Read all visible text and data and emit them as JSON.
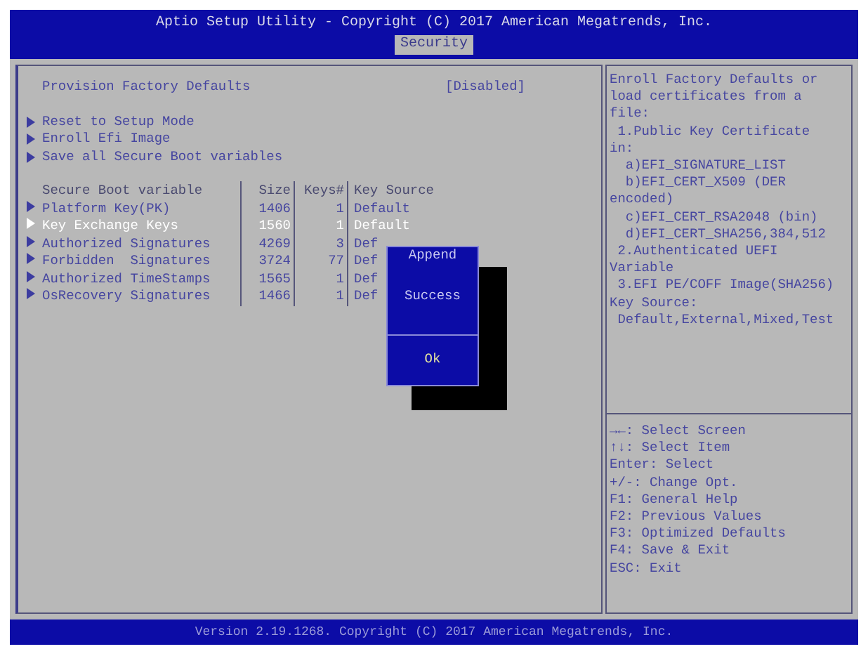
{
  "header": {
    "title": "Aptio Setup Utility - Copyright (C) 2017 American Megatrends, Inc.",
    "tabs": [
      {
        "label": "Security",
        "selected": true
      }
    ]
  },
  "settings": [
    {
      "kind": "option",
      "label": "Provision Factory Defaults",
      "value": "[Disabled]"
    },
    {
      "kind": "submenu",
      "label": "Reset to Setup Mode"
    },
    {
      "kind": "submenu",
      "label": "Enroll Efi Image"
    },
    {
      "kind": "submenu",
      "label": "Save all Secure Boot variables"
    }
  ],
  "table": {
    "columns": [
      "Secure Boot variable",
      "Size",
      "Keys#",
      "Key Source"
    ],
    "rows": [
      {
        "name": "Platform Key(PK)",
        "size": "1406",
        "keys": "1",
        "source": "Default",
        "selected": false
      },
      {
        "name": "Key Exchange Keys",
        "size": "1560",
        "keys": "1",
        "source": "Default",
        "selected": true
      },
      {
        "name": "Authorized Signatures",
        "size": "4269",
        "keys": "3",
        "source": "Def",
        "selected": false
      },
      {
        "name": "Forbidden  Signatures",
        "size": "3724",
        "keys": "77",
        "source": "Def",
        "selected": false
      },
      {
        "name": "Authorized TimeStamps",
        "size": "1565",
        "keys": "1",
        "source": "Def",
        "selected": false
      },
      {
        "name": "OsRecovery Signatures",
        "size": "1466",
        "keys": "1",
        "source": "Def",
        "selected": false
      }
    ]
  },
  "dialog": {
    "title": "Append",
    "message": "Success",
    "button": "Ok"
  },
  "help": [
    "Enroll Factory Defaults or",
    "load certificates from a",
    "file:",
    " 1.Public Key Certificate",
    "in:",
    "  a)EFI_SIGNATURE_LIST",
    "  b)EFI_CERT_X509 (DER",
    "encoded)",
    "  c)EFI_CERT_RSA2048 (bin)",
    "  d)EFI_CERT_SHA256,384,512",
    " 2.Authenticated UEFI",
    "Variable",
    " 3.EFI PE/COFF Image(SHA256)",
    "Key Source:",
    " Default,External,Mixed,Test"
  ],
  "keys": [
    "→←: Select Screen",
    "↑↓: Select Item",
    "Enter: Select",
    "+/-: Change Opt.",
    "F1: General Help",
    "F2: Previous Values",
    "F3: Optimized Defaults",
    "F4: Save & Exit",
    "ESC: Exit"
  ],
  "footer": "Version 2.19.1268. Copyright (C) 2017 American Megatrends, Inc."
}
